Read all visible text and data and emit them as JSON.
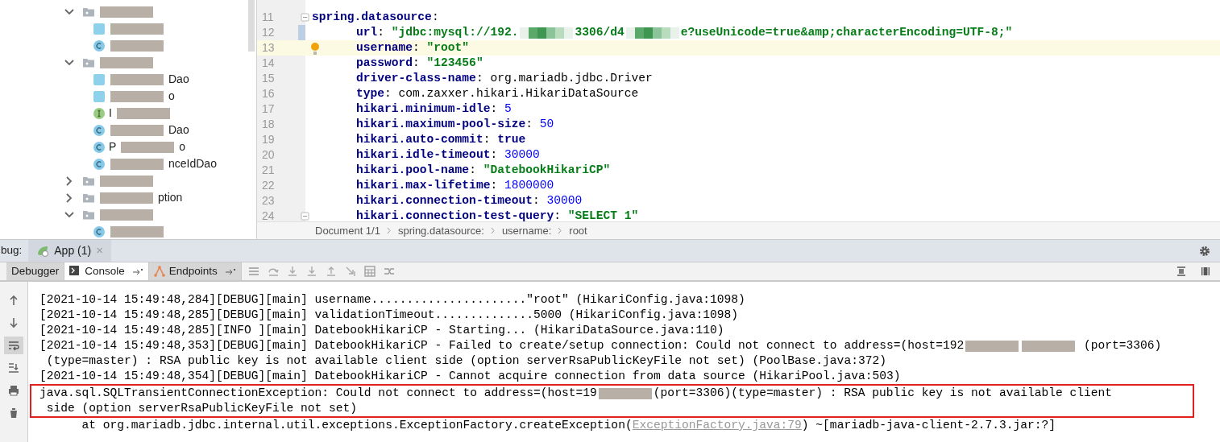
{
  "project_tree": {
    "items": [
      {
        "kind": "folder",
        "expanded": true,
        "segments": [
          {
            "kind": "redacted"
          }
        ],
        "children": [
          {
            "kind": "file",
            "segments": [
              {
                "kind": "redacted"
              }
            ]
          },
          {
            "kind": "class",
            "segments": [
              {
                "kind": "redacted"
              }
            ]
          }
        ]
      },
      {
        "kind": "folder",
        "expanded": true,
        "segments": [
          {
            "kind": "redacted"
          }
        ],
        "children": [
          {
            "kind": "file",
            "segments": [
              {
                "kind": "redacted"
              },
              {
                "kind": "text",
                "text": "Dao"
              }
            ]
          },
          {
            "kind": "file",
            "segments": [
              {
                "kind": "redacted"
              },
              {
                "kind": "text",
                "text": "o"
              }
            ]
          },
          {
            "kind": "interface",
            "segments": [
              {
                "kind": "text",
                "text": "I"
              },
              {
                "kind": "redacted"
              }
            ]
          },
          {
            "kind": "class",
            "segments": [
              {
                "kind": "redacted"
              },
              {
                "kind": "text",
                "text": "Dao"
              }
            ]
          },
          {
            "kind": "class",
            "segments": [
              {
                "kind": "text",
                "text": "P"
              },
              {
                "kind": "redacted"
              },
              {
                "kind": "text",
                "text": "o"
              }
            ]
          },
          {
            "kind": "class",
            "segments": [
              {
                "kind": "redacted"
              },
              {
                "kind": "text",
                "text": "nceIdDao"
              }
            ]
          }
        ]
      },
      {
        "kind": "folder",
        "expanded": false,
        "segments": [
          {
            "kind": "redacted"
          }
        ]
      },
      {
        "kind": "folder",
        "expanded": false,
        "segments": [
          {
            "kind": "redacted"
          },
          {
            "kind": "text",
            "text": "ption"
          }
        ]
      },
      {
        "kind": "folder",
        "expanded": true,
        "segments": [
          {
            "kind": "redacted"
          }
        ],
        "children": [
          {
            "kind": "class",
            "segments": [
              {
                "kind": "redacted"
              }
            ]
          }
        ]
      }
    ]
  },
  "editor": {
    "lines": [
      {
        "number": "11",
        "fold": true,
        "segments": [
          {
            "kind": "key",
            "text": "spring.datasource"
          },
          {
            "kind": "plain",
            "text": ":"
          }
        ]
      },
      {
        "number": "12",
        "indent": true,
        "modified": true,
        "segments": [
          {
            "kind": "key",
            "text": "url"
          },
          {
            "kind": "plain",
            "text": ": "
          },
          {
            "kind": "string",
            "text": "\"jdbc:mysql://192."
          },
          {
            "kind": "redacted"
          },
          {
            "kind": "string",
            "text": "3306/d4"
          },
          {
            "kind": "redacted"
          },
          {
            "kind": "string",
            "text": "e?useUnicode=true&amp;characterEncoding=UTF-8;\""
          }
        ]
      },
      {
        "number": "13",
        "indent": true,
        "current": true,
        "segments": [
          {
            "kind": "key",
            "text": "username"
          },
          {
            "kind": "plain",
            "text": ": "
          },
          {
            "kind": "string",
            "text": "\"root\""
          }
        ]
      },
      {
        "number": "14",
        "indent": true,
        "segments": [
          {
            "kind": "key",
            "text": "password"
          },
          {
            "kind": "plain",
            "text": ": "
          },
          {
            "kind": "string",
            "text": "\"123456\""
          }
        ]
      },
      {
        "number": "15",
        "indent": true,
        "segments": [
          {
            "kind": "key",
            "text": "driver-class-name"
          },
          {
            "kind": "plain",
            "text": ": org.mariadb.jdbc.Driver"
          }
        ]
      },
      {
        "number": "16",
        "indent": true,
        "segments": [
          {
            "kind": "key",
            "text": "type"
          },
          {
            "kind": "plain",
            "text": ": com.zaxxer.hikari.HikariDataSource"
          }
        ]
      },
      {
        "number": "17",
        "indent": true,
        "segments": [
          {
            "kind": "key",
            "text": "hikari.minimum-idle"
          },
          {
            "kind": "plain",
            "text": ": "
          },
          {
            "kind": "number",
            "text": "5"
          }
        ]
      },
      {
        "number": "18",
        "indent": true,
        "segments": [
          {
            "kind": "key",
            "text": "hikari.maximum-pool-size"
          },
          {
            "kind": "plain",
            "text": ": "
          },
          {
            "kind": "number",
            "text": "50"
          }
        ]
      },
      {
        "number": "19",
        "indent": true,
        "segments": [
          {
            "kind": "key",
            "text": "hikari.auto-commit"
          },
          {
            "kind": "plain",
            "text": ": "
          },
          {
            "kind": "key",
            "text": "true"
          }
        ]
      },
      {
        "number": "20",
        "indent": true,
        "segments": [
          {
            "kind": "key",
            "text": "hikari.idle-timeout"
          },
          {
            "kind": "plain",
            "text": ": "
          },
          {
            "kind": "number",
            "text": "30000"
          }
        ]
      },
      {
        "number": "21",
        "indent": true,
        "segments": [
          {
            "kind": "key",
            "text": "hikari.pool-name"
          },
          {
            "kind": "plain",
            "text": ": "
          },
          {
            "kind": "string",
            "text": "\"DatebookHikariCP\""
          }
        ]
      },
      {
        "number": "22",
        "indent": true,
        "segments": [
          {
            "kind": "key",
            "text": "hikari.max-lifetime"
          },
          {
            "kind": "plain",
            "text": ": "
          },
          {
            "kind": "number",
            "text": "1800000"
          }
        ]
      },
      {
        "number": "23",
        "indent": true,
        "segments": [
          {
            "kind": "key",
            "text": "hikari.connection-timeout"
          },
          {
            "kind": "plain",
            "text": ": "
          },
          {
            "kind": "number",
            "text": "30000"
          }
        ]
      },
      {
        "number": "24",
        "indent": true,
        "fold": true,
        "segments": [
          {
            "kind": "key",
            "text": "hikari.connection-test-query"
          },
          {
            "kind": "plain",
            "text": ": "
          },
          {
            "kind": "string",
            "text": "\"SELECT 1\""
          }
        ]
      }
    ],
    "breadcrumb": [
      "Document 1/1",
      "spring.datasource:",
      "username:",
      "root"
    ]
  },
  "debug": {
    "label": "bug:",
    "session_tab": {
      "label": "App (1)",
      "close": "×"
    },
    "tabs": [
      {
        "label": "Debugger",
        "selected": false,
        "pin": false
      },
      {
        "label": "Console",
        "selected": true,
        "pin": true
      },
      {
        "label": "Endpoints",
        "selected": false,
        "pin": true
      }
    ],
    "console": {
      "soft_wrap": true,
      "lines": [
        {
          "segments": [
            {
              "kind": "text",
              "text": "[2021-10-14 15:49:48,284][DEBUG][main] username......................\"root\" (HikariConfig.java:1098)"
            }
          ]
        },
        {
          "segments": [
            {
              "kind": "text",
              "text": "[2021-10-14 15:49:48,285][DEBUG][main] validationTimeout..............5000 (HikariConfig.java:1098)"
            }
          ]
        },
        {
          "segments": [
            {
              "kind": "text",
              "text": "[2021-10-14 15:49:48,285][INFO ][main] DatebookHikariCP - Starting... (HikariDataSource.java:110)"
            }
          ]
        },
        {
          "segments": [
            {
              "kind": "text",
              "text": "[2021-10-14 15:49:48,353][DEBUG][main] DatebookHikariCP - Failed to create/setup connection: Could not connect to address=(host=192"
            },
            {
              "kind": "redacted"
            },
            {
              "kind": "redacted"
            },
            {
              "kind": "text",
              "text": " (port=3306)"
            }
          ]
        },
        {
          "segments": [
            {
              "kind": "text",
              "text": " (type=master) : RSA public key is not available client side (option serverRsaPublicKeyFile not set) (PoolBase.java:372)"
            }
          ]
        },
        {
          "segments": [
            {
              "kind": "text",
              "text": "[2021-10-14 15:49:48,354][DEBUG][main] DatebookHikariCP - Cannot acquire connection from data source (HikariPool.java:503)"
            }
          ]
        },
        {
          "highlighted": true,
          "segments": [
            {
              "kind": "text",
              "text": "java.sql.SQLTransientConnectionException: Could not connect to address=(host=19"
            },
            {
              "kind": "redacted"
            },
            {
              "kind": "text",
              "text": "(port=3306)(type=master) : RSA public key is not available client"
            }
          ]
        },
        {
          "highlighted": true,
          "segments": [
            {
              "kind": "text",
              "text": " side (option serverRsaPublicKeyFile not set)"
            }
          ]
        },
        {
          "segments": [
            {
              "kind": "text",
              "text": "\tat org.mariadb.jdbc.internal.util.exceptions.ExceptionFactory.createException("
            },
            {
              "kind": "link",
              "text": "ExceptionFactory.java:79"
            },
            {
              "kind": "text",
              "text": ") ~[mariadb-java-client-2.7.3.jar:?]"
            }
          ]
        }
      ]
    }
  }
}
